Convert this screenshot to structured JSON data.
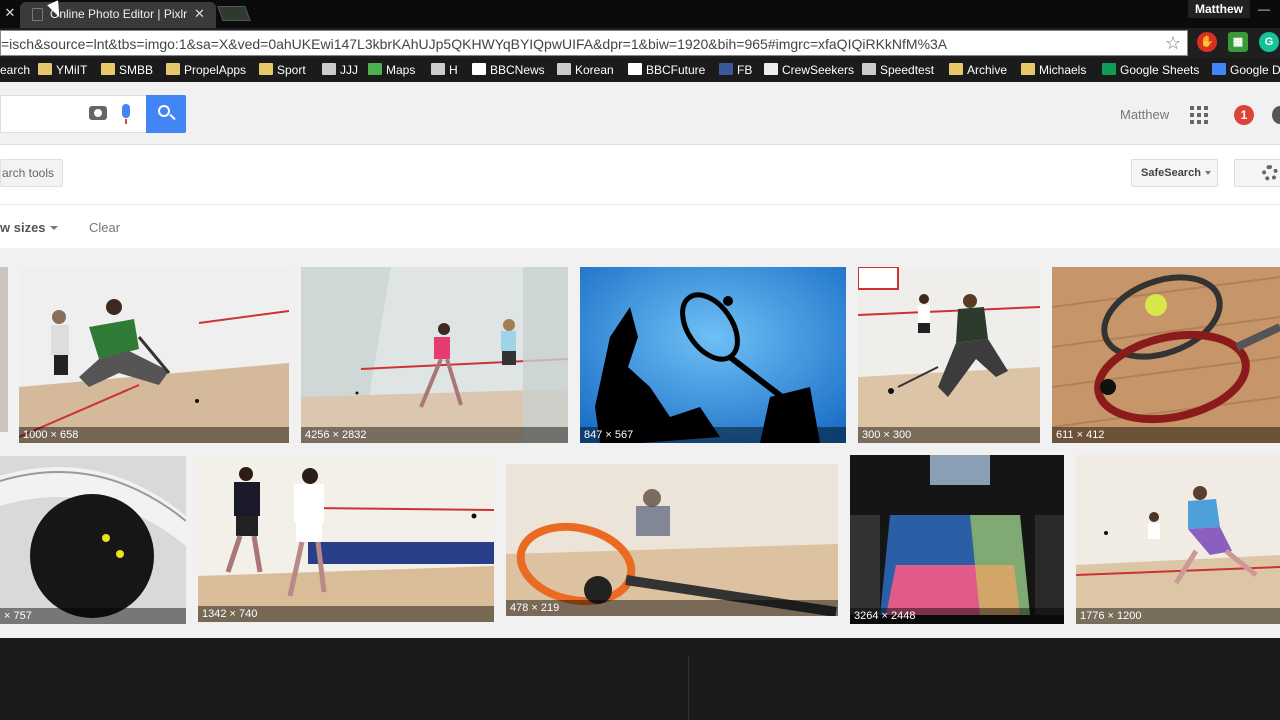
{
  "browser": {
    "tab_title": "Online Photo Editor | Pixlr",
    "profile_name": "Matthew",
    "url": "=isch&source=lnt&tbs=imgo:1&sa=X&ved=0ahUKEwi147L3kbrKAhUJp5QKHWYqBYIQpwUIFA&dpr=1&biw=1920&bih=965#imgrc=xfaQIQiRKkNfM%3A",
    "extensions": [
      {
        "name": "adblock-icon",
        "color": "#d93025",
        "glyph": "✋"
      },
      {
        "name": "green-ext-icon",
        "color": "#3a9a3a",
        "glyph": "▦"
      },
      {
        "name": "grammarly-icon",
        "color": "#15c39a",
        "glyph": "G"
      }
    ]
  },
  "bookmarks": [
    {
      "label": "earch",
      "icon": "none"
    },
    {
      "label": "YMiIT",
      "icon": "folder"
    },
    {
      "label": "SMBB",
      "icon": "folder"
    },
    {
      "label": "PropelApps",
      "icon": "folder"
    },
    {
      "label": "Sport",
      "icon": "folder"
    },
    {
      "label": "JJJ",
      "icon": "site"
    },
    {
      "label": "Maps",
      "icon": "maps"
    },
    {
      "label": "H",
      "icon": "site"
    },
    {
      "label": "BBCNews",
      "icon": "bbc"
    },
    {
      "label": "Korean",
      "icon": "site"
    },
    {
      "label": "BBCFuture",
      "icon": "bbc"
    },
    {
      "label": "FB",
      "icon": "facebook"
    },
    {
      "label": "CrewSeekers",
      "icon": "page"
    },
    {
      "label": "Speedtest",
      "icon": "site"
    },
    {
      "label": "Archive",
      "icon": "folder"
    },
    {
      "label": "Michaels",
      "icon": "folder"
    },
    {
      "label": "Google Sheets",
      "icon": "sheets"
    },
    {
      "label": "Google D",
      "icon": "docs"
    }
  ],
  "page": {
    "user_name": "Matthew",
    "notification_count": "1",
    "search_tools_label": "arch tools",
    "safesearch_label": "SafeSearch",
    "sizes_filter_label": "w sizes",
    "clear_label": "Clear"
  },
  "results": [
    {
      "dims": "",
      "desc": "partial left image"
    },
    {
      "dims": "1000 × 658",
      "desc": "squash players green shirt"
    },
    {
      "dims": "4256 × 2832",
      "desc": "women squash court glass"
    },
    {
      "dims": "847 × 567",
      "desc": "silhouette racket blue"
    },
    {
      "dims": "300 × 300",
      "desc": "two players court"
    },
    {
      "dims": "611 × 412",
      "desc": "rackets and balls on floor"
    },
    {
      "dims": "× 757",
      "desc": "black squash ball racket"
    },
    {
      "dims": "1342 × 740",
      "desc": "two men playing squash"
    },
    {
      "dims": "478 × 219",
      "desc": "orange racket ball"
    },
    {
      "dims": "3264 × 2448",
      "desc": "glass court arena"
    },
    {
      "dims": "1776 × 1200",
      "desc": "players purple shorts"
    }
  ],
  "colors": {
    "accent": "#4285f4",
    "notification": "#db4437"
  }
}
